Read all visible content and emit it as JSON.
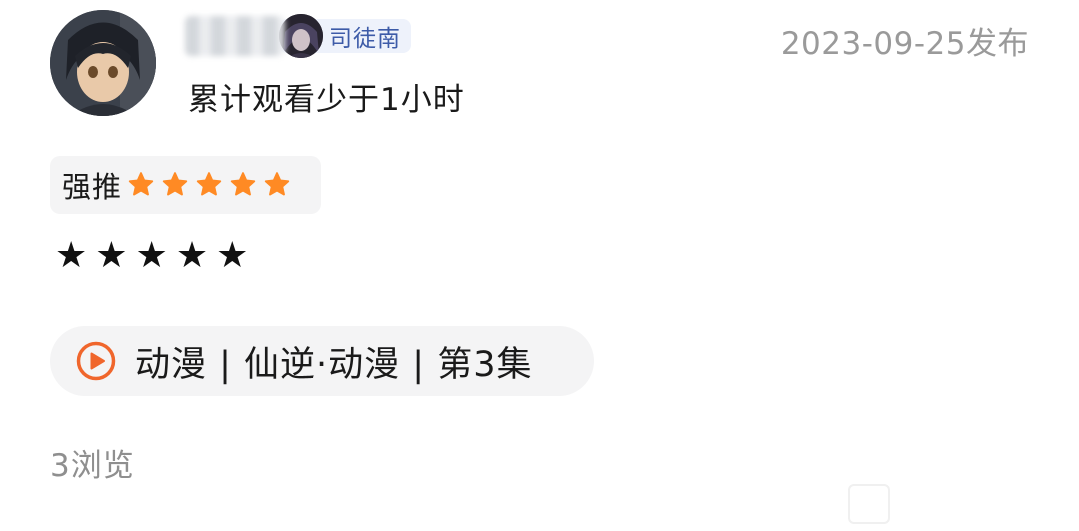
{
  "review": {
    "user": {
      "badge_name": "司徒南"
    },
    "watch_time": "累计观看少于1小时",
    "publish_date": "2023-09-25发布",
    "rating": {
      "label": "强推",
      "stars": 5,
      "max_stars": 5,
      "star_color": "#FF8A24"
    },
    "text": "★★★★★",
    "episode": {
      "label": "动漫 | 仙逆·动漫 | 第3集",
      "icon": "play-circle-icon",
      "icon_color": "#F0662C"
    },
    "views": "3浏览"
  },
  "colors": {
    "badge_text": "#3D5BA8",
    "badge_bg": "#EEF2FB",
    "muted_text": "#9A9A9A",
    "chip_bg": "#F4F4F5"
  }
}
